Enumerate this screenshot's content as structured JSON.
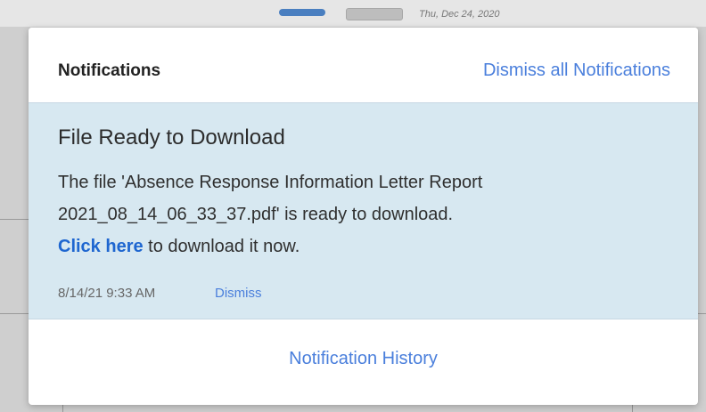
{
  "background": {
    "date_text": "Thu, Dec 24, 2020"
  },
  "notifications": {
    "title": "Notifications",
    "dismiss_all_label": "Dismiss all Notifications",
    "items": [
      {
        "title": "File Ready to Download",
        "message_prefix": "The file 'Absence Response Information Letter Report 2021_08_14_06_33_37.pdf' is ready to download.",
        "link_text": "Click here",
        "message_suffix": " to download it now.",
        "timestamp": "8/14/21 9:33 AM",
        "dismiss_label": "Dismiss"
      }
    ],
    "history_label": "Notification History"
  },
  "colors": {
    "accent": "#4a7fdc",
    "card_bg": "#d7e8f1",
    "link_strong": "#1e66d0"
  }
}
